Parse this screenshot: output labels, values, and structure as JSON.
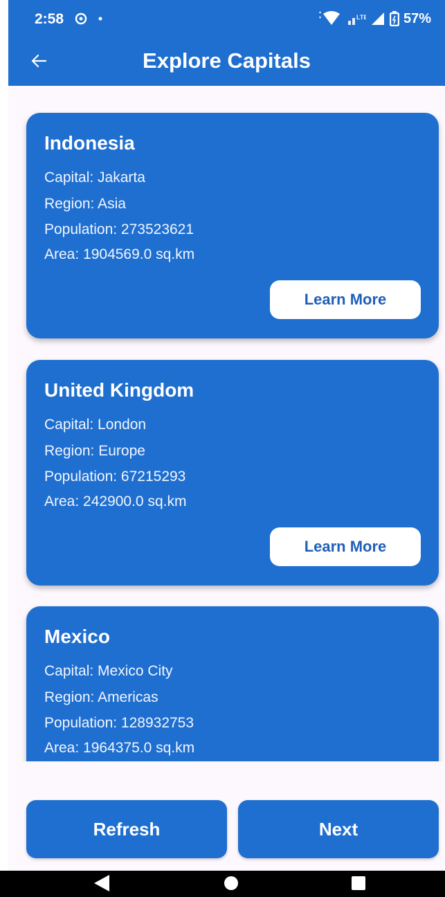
{
  "status_bar": {
    "time": "2:58",
    "battery": "57%",
    "network": "LTE"
  },
  "app_bar": {
    "title": "Explore Capitals",
    "back_icon": "arrow-left-icon"
  },
  "countries": [
    {
      "name": "Indonesia",
      "capital": "Capital: Jakarta",
      "region": "Region: Asia",
      "population": "Population: 273523621",
      "area": "Area: 1904569.0 sq.km",
      "button": "Learn More"
    },
    {
      "name": "United Kingdom",
      "capital": "Capital: London",
      "region": "Region: Europe",
      "population": "Population: 67215293",
      "area": "Area: 242900.0 sq.km",
      "button": "Learn More"
    },
    {
      "name": "Mexico",
      "capital": "Capital: Mexico City",
      "region": "Region: Americas",
      "population": "Population: 128932753",
      "area": "Area: 1964375.0 sq.km"
    }
  ],
  "actions": {
    "refresh": "Refresh",
    "next": "Next"
  },
  "colors": {
    "primary": "#1f6fd0",
    "background": "#fcf8fd",
    "on_primary": "#ffffff"
  }
}
